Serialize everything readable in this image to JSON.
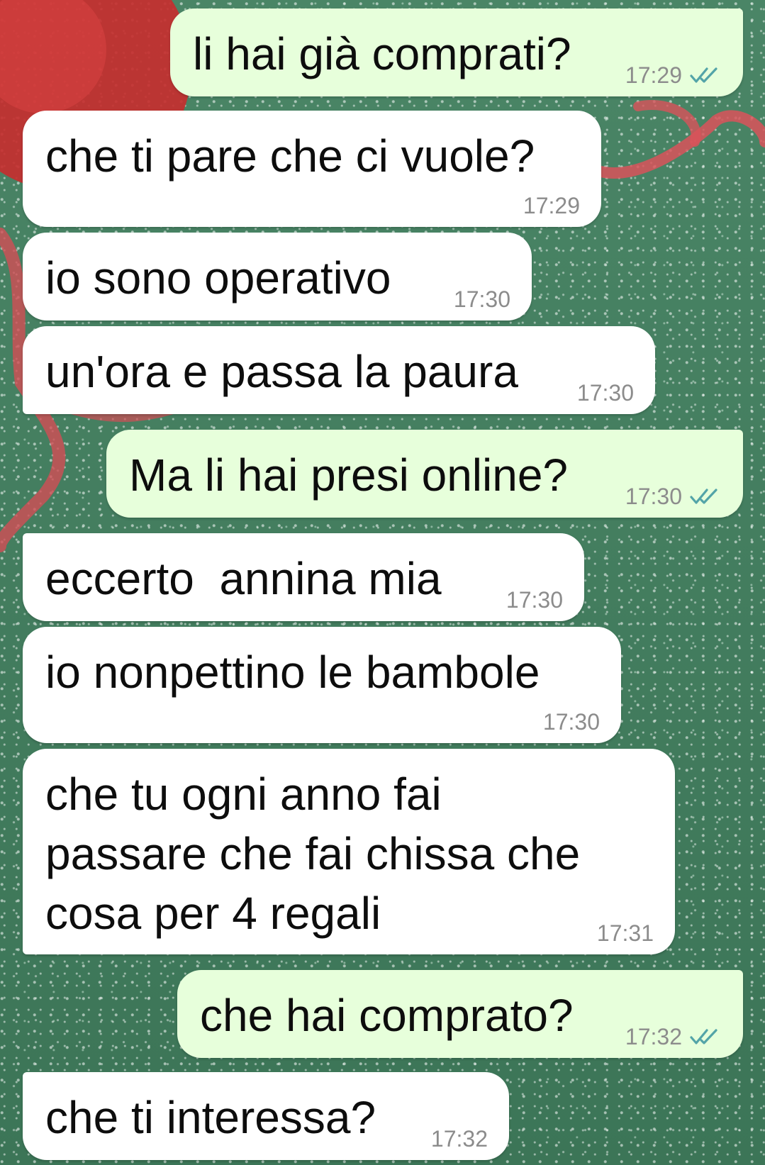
{
  "theme": {
    "incoming_bg": "#ffffff",
    "outgoing_bg": "#e7ffdb",
    "wallpaper": "#3f7a5c",
    "read_tick_color": "#53a4a8"
  },
  "messages": [
    {
      "direction": "out",
      "text": "li hai già comprati?",
      "time": "17:29",
      "status_icon": "double-check-icon"
    },
    {
      "direction": "in",
      "text": "che ti pare che ci vuole?",
      "time": "17:29"
    },
    {
      "direction": "in",
      "text": "io sono operativo",
      "time": "17:30"
    },
    {
      "direction": "in",
      "text": "un'ora e passa la paura",
      "time": "17:30"
    },
    {
      "direction": "out",
      "text": "Ma li hai presi online?",
      "time": "17:30",
      "status_icon": "double-check-icon"
    },
    {
      "direction": "in",
      "text": "eccerto  annina mia",
      "time": "17:30"
    },
    {
      "direction": "in",
      "text": "io nonpettino le bambole",
      "time": "17:30"
    },
    {
      "direction": "in",
      "text": "che tu ogni anno fai\npassare che fai chissa che\ncosa per 4 regali",
      "time": "17:31"
    },
    {
      "direction": "out",
      "text": "che hai comprato?",
      "time": "17:32",
      "status_icon": "double-check-icon"
    },
    {
      "direction": "in",
      "text": "che ti interessa?",
      "time": "17:32"
    }
  ]
}
